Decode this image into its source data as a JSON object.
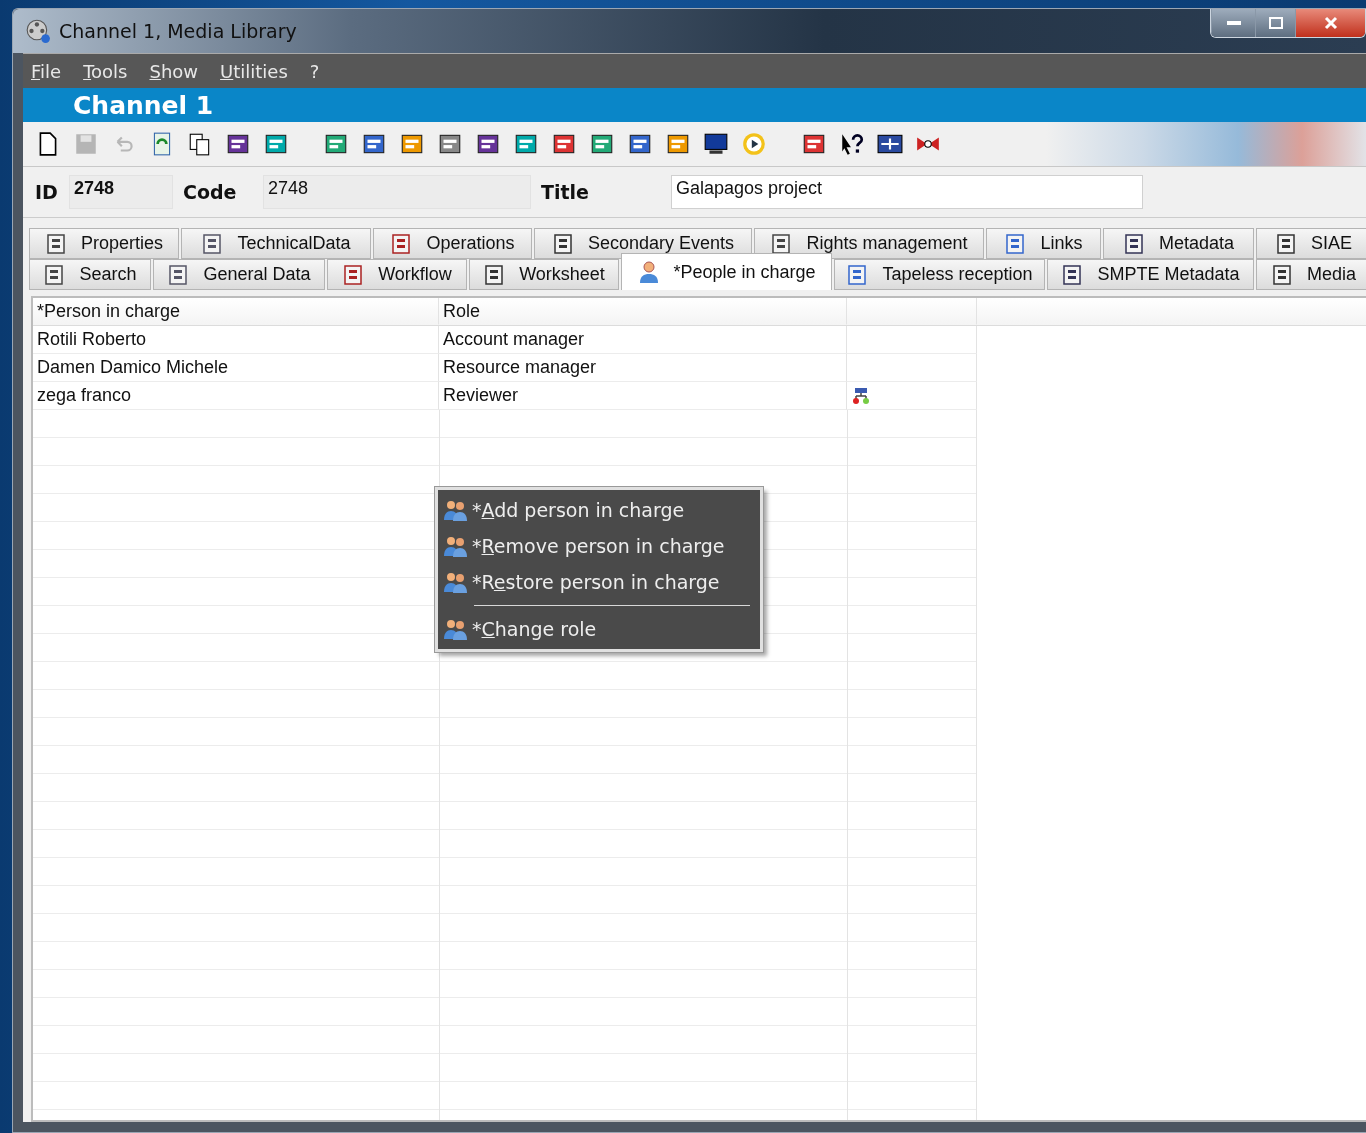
{
  "window": {
    "title": "Channel 1, Media Library"
  },
  "menu": [
    {
      "key": "F",
      "after": "ile"
    },
    {
      "key": "T",
      "after": "ools"
    },
    {
      "key": "S",
      "after": "how"
    },
    {
      "key": "U",
      "after": "tilities"
    },
    {
      "after": "?"
    }
  ],
  "header": {
    "title": "Channel 1"
  },
  "toolbar": [
    {
      "kind": "document",
      "disabled": false
    },
    {
      "kind": "disk",
      "disabled": true
    },
    {
      "kind": "undo",
      "disabled": true
    },
    {
      "kind": "refresh",
      "disabled": false
    },
    {
      "kind": "copy",
      "disabled": false
    },
    {
      "kind": "cogs",
      "disabled": false
    },
    {
      "kind": "brush",
      "disabled": false
    },
    {
      "kind": "gap"
    },
    {
      "kind": "reel",
      "disabled": false
    },
    {
      "kind": "film",
      "disabled": false
    },
    {
      "kind": "cut",
      "disabled": false
    },
    {
      "kind": "pages",
      "disabled": false
    },
    {
      "kind": "binoculars",
      "disabled": false
    },
    {
      "kind": "windows",
      "disabled": false
    },
    {
      "kind": "preview",
      "disabled": false
    },
    {
      "kind": "printer",
      "disabled": false
    },
    {
      "kind": "clapper",
      "disabled": false
    },
    {
      "kind": "grid",
      "disabled": false
    },
    {
      "kind": "monitor",
      "disabled": false
    },
    {
      "kind": "play",
      "disabled": false
    },
    {
      "kind": "gap"
    },
    {
      "kind": "live",
      "disabled": false
    },
    {
      "kind": "help",
      "disabled": false
    },
    {
      "kind": "arrows",
      "disabled": false
    },
    {
      "kind": "connect",
      "disabled": false
    }
  ],
  "fields": {
    "id_label": "ID",
    "id": "2748",
    "code_label": "Code",
    "code": "2748",
    "title_label": "Title",
    "title": "Galapagos project"
  },
  "tabs_row_1": [
    {
      "label": "Properties",
      "selected": false
    },
    {
      "label": "TechnicalData",
      "selected": false
    },
    {
      "label": "Operations",
      "selected": false
    },
    {
      "label": "Secondary Events",
      "selected": false
    },
    {
      "label": "Rights management",
      "selected": false
    },
    {
      "label": "Links",
      "selected": false
    },
    {
      "label": "Metadata",
      "selected": false
    },
    {
      "label": "SIAE",
      "selected": false
    }
  ],
  "tabs_row_2": [
    {
      "label": "Search",
      "selected": false
    },
    {
      "label": "General Data",
      "selected": false
    },
    {
      "label": "Workflow",
      "selected": false
    },
    {
      "label": "Worksheet",
      "selected": false
    },
    {
      "label": "*People in charge",
      "selected": true
    },
    {
      "label": "Tapeless reception",
      "selected": false
    },
    {
      "label": "SMPTE Metadata",
      "selected": false
    },
    {
      "label": "Media",
      "selected": false
    }
  ],
  "table": {
    "columns": [
      "*Person in charge",
      "Role"
    ],
    "rows": [
      {
        "person": "Rotili Roberto",
        "role": "Account manager",
        "flagged": false
      },
      {
        "person": "Damen Damico Michele",
        "role": "Resource manager",
        "flagged": false
      },
      {
        "person": "zega franco",
        "role": "Reviewer",
        "flagged": true
      }
    ]
  },
  "context_menu": [
    {
      "kind": "item",
      "before": "*",
      "key": "A",
      "after": "dd person in charge"
    },
    {
      "kind": "item",
      "before": "*",
      "key": "R",
      "after": "emove person in charge"
    },
    {
      "kind": "item",
      "before": "*R",
      "key": "e",
      "after": "store person in charge"
    },
    {
      "kind": "separator"
    },
    {
      "kind": "item",
      "before": "*",
      "key": "C",
      "after": "hange role"
    }
  ]
}
